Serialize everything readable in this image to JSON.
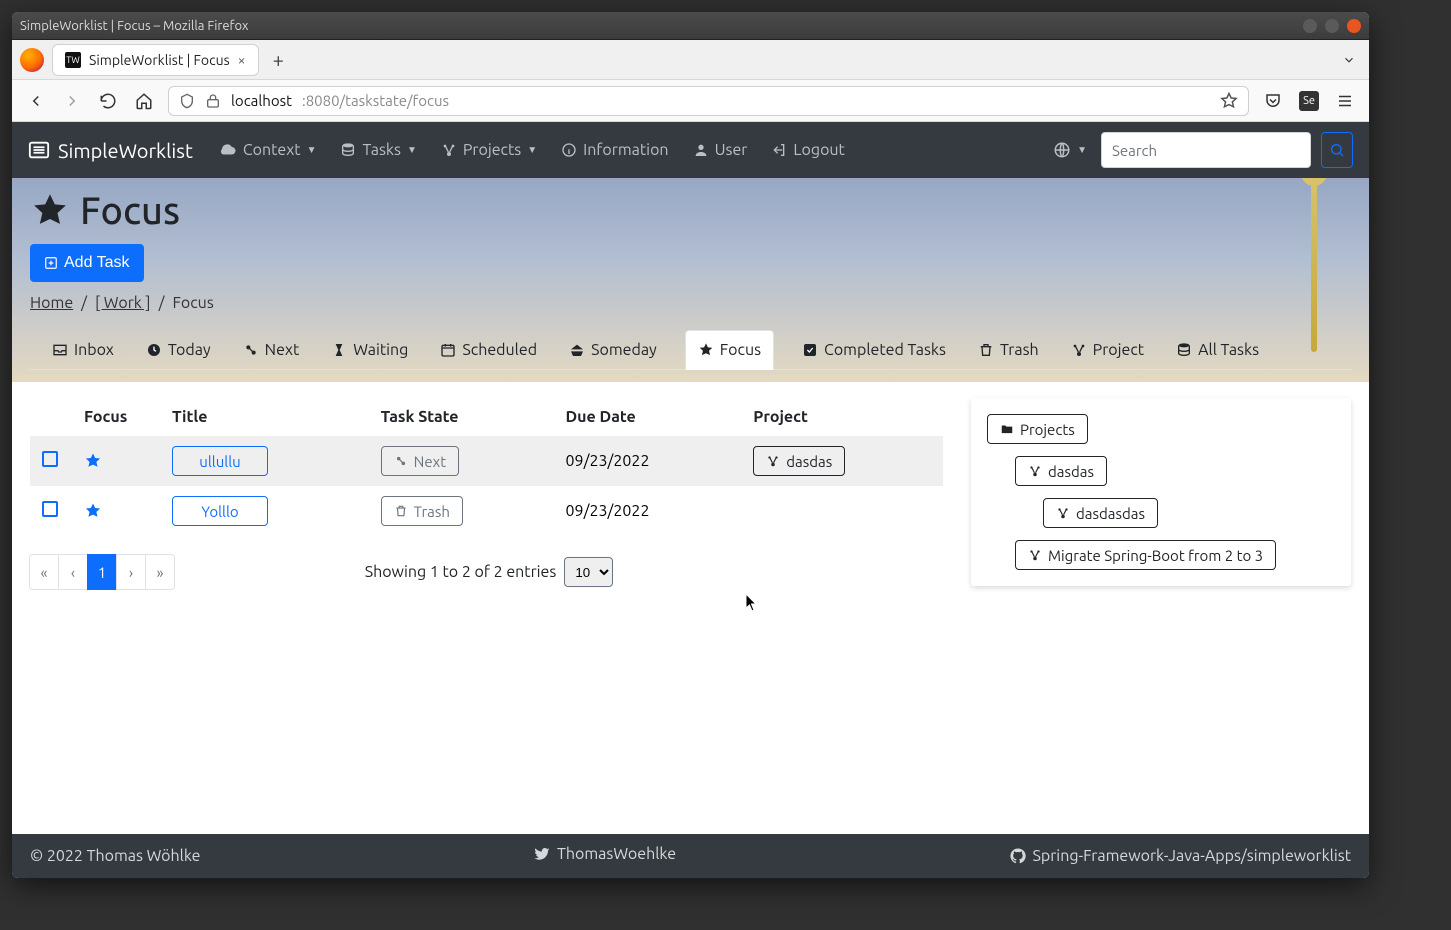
{
  "window": {
    "title": "SimpleWorklist | Focus – Mozilla Firefox",
    "tab_title": "SimpleWorklist | Focus",
    "tab_favicon_text": "TW"
  },
  "urlbar": {
    "host": "localhost",
    "port_path": ":8080/taskstate/focus"
  },
  "navbar": {
    "brand": "SimpleWorklist",
    "items": {
      "context": "Context",
      "tasks": "Tasks",
      "projects": "Projects",
      "information": "Information",
      "user": "User",
      "logout": "Logout"
    },
    "search_placeholder": "Search"
  },
  "page": {
    "title": "Focus",
    "add_task": "Add Task"
  },
  "breadcrumb": {
    "home": "Home",
    "work": "[ Work ]",
    "current": "Focus"
  },
  "tabs": {
    "inbox": "Inbox",
    "today": "Today",
    "next": "Next",
    "waiting": "Waiting",
    "scheduled": "Scheduled",
    "someday": "Someday",
    "focus": "Focus",
    "completed": "Completed Tasks",
    "trash": "Trash",
    "project": "Project",
    "all": "All Tasks"
  },
  "table": {
    "headers": {
      "focus": "Focus",
      "title": "Title",
      "task_state": "Task State",
      "due_date": "Due Date",
      "project": "Project"
    },
    "rows": [
      {
        "title": "ullullu",
        "state": "Next",
        "state_icon": "cogs",
        "due": "09/23/2022",
        "project": "dasdas"
      },
      {
        "title": "Yolllo",
        "state": "Trash",
        "state_icon": "trash",
        "due": "09/23/2022",
        "project": ""
      }
    ]
  },
  "pagination": {
    "first": "«",
    "prev": "‹",
    "pages": [
      "1"
    ],
    "next": "›",
    "last": "»",
    "showing": "Showing 1 to 2 of 2 entries",
    "page_size": "10"
  },
  "sidebar": {
    "projects_label": "Projects",
    "items": [
      {
        "label": "dasdas",
        "indent": 1
      },
      {
        "label": "dasdasdas",
        "indent": 2
      },
      {
        "label": "Migrate Spring-Boot from 2 to 3",
        "indent": 1
      }
    ]
  },
  "footer": {
    "copyright": "© 2022 Thomas Wöhlke",
    "twitter": "ThomasWoehlke",
    "github": "Spring-Framework-Java-Apps/simpleworklist"
  },
  "colors": {
    "primary": "#0d6efd",
    "dark": "#343a40",
    "muted": "#6c757d"
  }
}
